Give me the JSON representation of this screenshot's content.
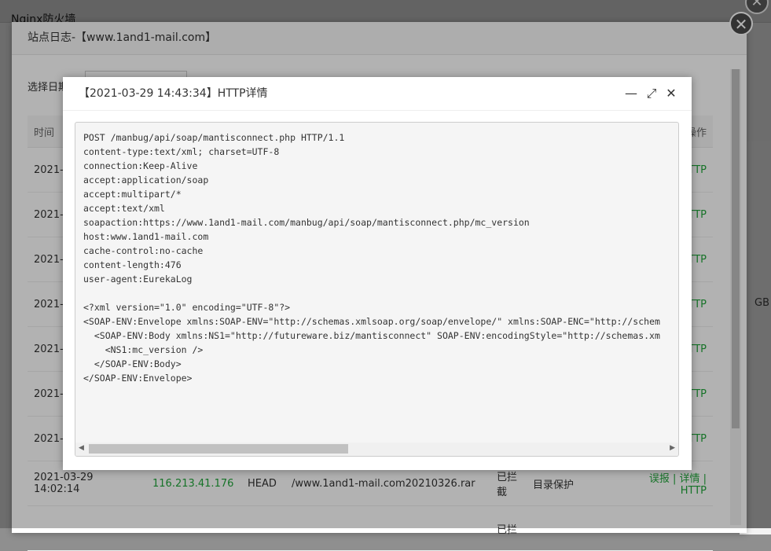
{
  "background": {
    "title": "Nginx防火墙",
    "right_text": "GB"
  },
  "log_window": {
    "title": "站点日志-【www.1and1-mail.com】",
    "close": "✕",
    "date_label": "选择日期",
    "columns": [
      "时间",
      "",
      "",
      "",
      "",
      "",
      "操作"
    ],
    "rows": [
      {
        "time": "2021-",
        "ip": "",
        "method": "",
        "url": "",
        "status": "",
        "rule": "",
        "actions": "TTP"
      },
      {
        "time": "2021-",
        "ip": "",
        "method": "",
        "url": "",
        "status": "",
        "rule": "",
        "actions": "TTP"
      },
      {
        "time": "2021-",
        "ip": "",
        "method": "",
        "url": "",
        "status": "",
        "rule": "",
        "actions": "TTP"
      },
      {
        "time": "2021-",
        "ip": "",
        "method": "",
        "url": "",
        "status": "",
        "rule": "",
        "actions": "TTP"
      },
      {
        "time": "2021-",
        "ip": "",
        "method": "",
        "url": "",
        "status": "",
        "rule": "",
        "actions": "TTP"
      },
      {
        "time": "2021-",
        "ip": "",
        "method": "",
        "url": "",
        "status": "",
        "rule": "",
        "actions": "TTP"
      },
      {
        "time": "2021-",
        "ip": "",
        "method": "",
        "url": "",
        "status": "",
        "rule": "",
        "actions": "TTP"
      },
      {
        "time": "2021-03-29 14:02:14",
        "ip": "116.213.41.176",
        "method": "HEAD",
        "url": "/www.1and1-mail.com20210326.rar",
        "status": "已拦截",
        "rule": "目录保护",
        "actions": "误报 | 详情 | HTTP"
      },
      {
        "time": "",
        "ip": "",
        "method": "",
        "url": "",
        "status": "已拦",
        "rule": "",
        "actions": ""
      }
    ]
  },
  "detail_dialog": {
    "title": "【2021-03-29 14:43:34】HTTP详情",
    "minimize": "—",
    "maximize": "⤢",
    "close": "✕",
    "content": "POST /manbug/api/soap/mantisconnect.php HTTP/1.1\ncontent-type:text/xml; charset=UTF-8\nconnection:Keep-Alive\naccept:application/soap\naccept:multipart/*\naccept:text/xml\nsoapaction:https://www.1and1-mail.com/manbug/api/soap/mantisconnect.php/mc_version\nhost:www.1and1-mail.com\ncache-control:no-cache\ncontent-length:476\nuser-agent:EurekaLog\n\n<?xml version=\"1.0\" encoding=\"UTF-8\"?>\n<SOAP-ENV:Envelope xmlns:SOAP-ENV=\"http://schemas.xmlsoap.org/soap/envelope/\" xmlns:SOAP-ENC=\"http://schem\n  <SOAP-ENV:Body xmlns:NS1=\"http://futureware.biz/mantisconnect\" SOAP-ENV:encodingStyle=\"http://schemas.xm\n    <NS1:mc_version />\n  </SOAP-ENV:Body>\n</SOAP-ENV:Envelope>",
    "scroll_left": "◀",
    "scroll_right": "▶"
  }
}
